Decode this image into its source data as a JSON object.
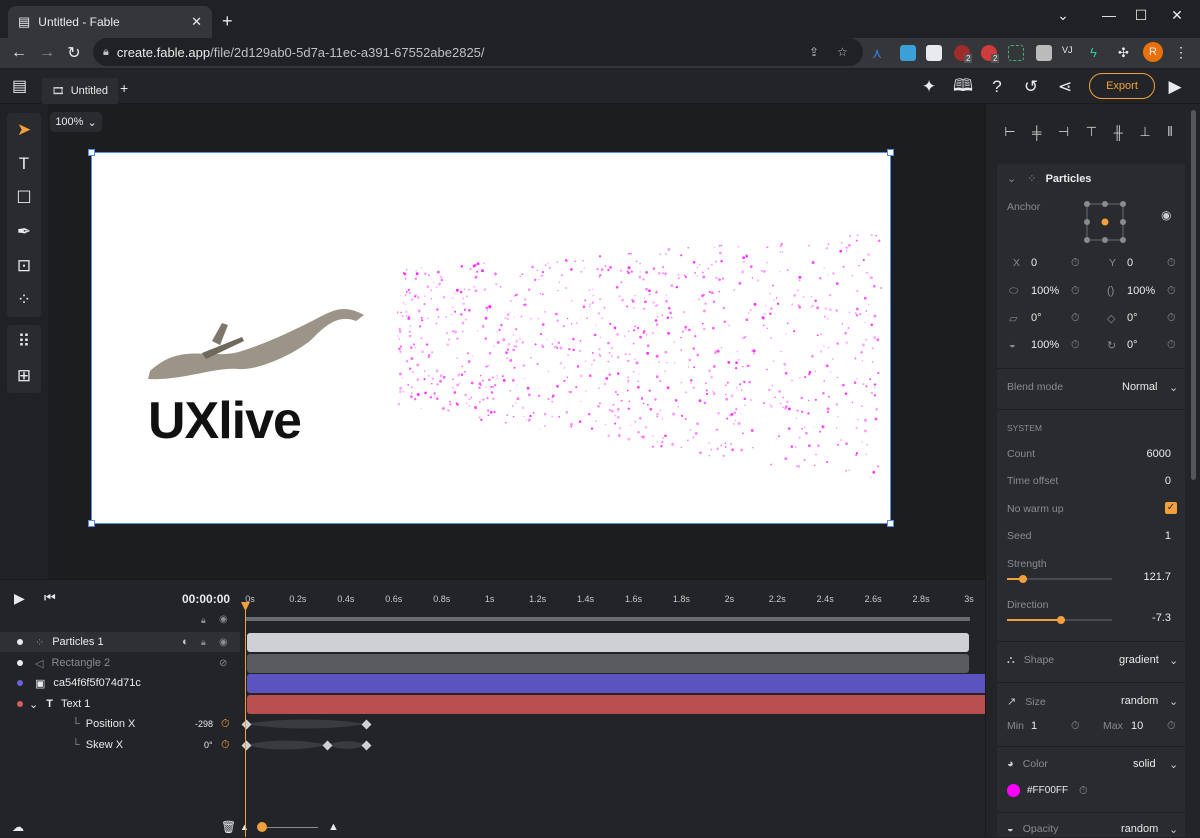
{
  "browser": {
    "tab_title": "Untitled - Fable",
    "url_host": "create.fable.app",
    "url_path": "/file/2d129ab0-5d7a-11ec-a391-67552abe2825/",
    "profile_initial": "R",
    "ext_badge_1": "2",
    "ext_badge_2": "2",
    "ext_vj": "VJ"
  },
  "app": {
    "file_tab": "Untitled",
    "export_label": "Export",
    "zoom": "100%"
  },
  "canvas": {
    "logo_text": "UXlive"
  },
  "timeline": {
    "timecode": "00:00:00",
    "ticks": [
      "0s",
      "0.2s",
      "0.4s",
      "0.6s",
      "0.8s",
      "1s",
      "1.2s",
      "1.4s",
      "1.6s",
      "1.8s",
      "2s",
      "2.2s",
      "2.4s",
      "2.6s",
      "2.8s",
      "3s"
    ],
    "layers": [
      {
        "name": "Particles 1",
        "dot": "#e8eaed",
        "bar": "#cfd0d3"
      },
      {
        "name": "Rectangle 2",
        "dot": "#e8eaed",
        "bar": "#5a5b5f"
      },
      {
        "name": "ca54f6f5f074d71c",
        "dot": "#6a63d6",
        "bar": "#5a53c0"
      },
      {
        "name": "Text 1",
        "dot": "#d85a5a",
        "bar": "#b94f4f"
      }
    ],
    "props": [
      {
        "name": "Position X",
        "value": "-298"
      },
      {
        "name": "Skew X",
        "value": "0°"
      }
    ]
  },
  "panel": {
    "section": "Particles",
    "anchor_label": "Anchor",
    "x_label": "X",
    "x_val": "0",
    "y_label": "Y",
    "y_val": "0",
    "scale_w": "100%",
    "scale_h": "100%",
    "rot_1": "0°",
    "rot_2": "0°",
    "opacity": "100%",
    "rot_3": "0°",
    "blend_label": "Blend mode",
    "blend_val": "Normal",
    "system_label": "SYSTEM",
    "count_label": "Count",
    "count_val": "6000",
    "time_offset_label": "Time offset",
    "time_offset_val": "0",
    "warm_label": "No warm up",
    "seed_label": "Seed",
    "seed_val": "1",
    "strength_label": "Strength",
    "strength_val": "121.7",
    "direction_label": "Direction",
    "direction_val": "-7.3",
    "shape_label": "Shape",
    "shape_val": "gradient",
    "size_label": "Size",
    "size_val": "random",
    "min_label": "Min",
    "min_val": "1",
    "max_label": "Max",
    "max_val": "10",
    "color_label": "Color",
    "color_val": "solid",
    "color_hex": "#FF00FF",
    "opacity_label": "Opacity",
    "opacity_val": "random"
  },
  "colors": {
    "accent": "#f2a03d",
    "particle": "#FF00FF"
  }
}
